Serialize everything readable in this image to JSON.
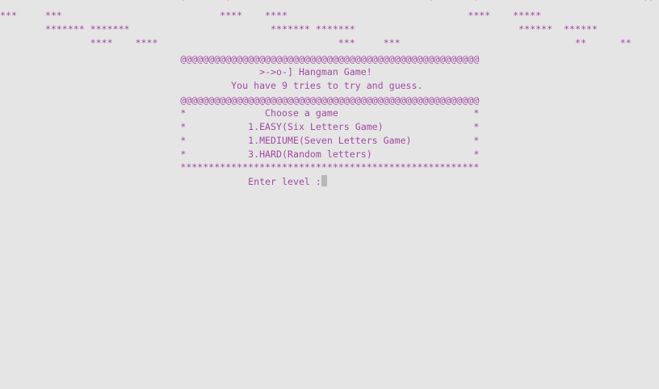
{
  "console": {
    "lines": [
      "                                *       *                                   *       *                             **",
      "***     ***                            ****    ****                                ****    *****",
      "        ******* *******                         ******* *******                             ******  ******",
      "                ****    ****                                ***     ***                               **      **",
      "                                @@@@@@@@@@@@@@@@@@@@@@@@@@@@@@@@@@@@@@@@@@@@@@@@@@@@@",
      "                                              >->o-] Hangman Game!",
      "                                         You have 9 tries to try and guess.",
      "                                @@@@@@@@@@@@@@@@@@@@@@@@@@@@@@@@@@@@@@@@@@@@@@@@@@@@@",
      "                                *              Choose a game                        *",
      "                                *           1.EASY(Six Letters Game)                *",
      "                                *           1.MEDIUME(Seven Letters Game)           *",
      "                                *           3.HARD(Random letters)                  *",
      "                                *****************************************************"
    ],
    "prompt_indent": "                                            ",
    "prompt": "Enter level :"
  }
}
